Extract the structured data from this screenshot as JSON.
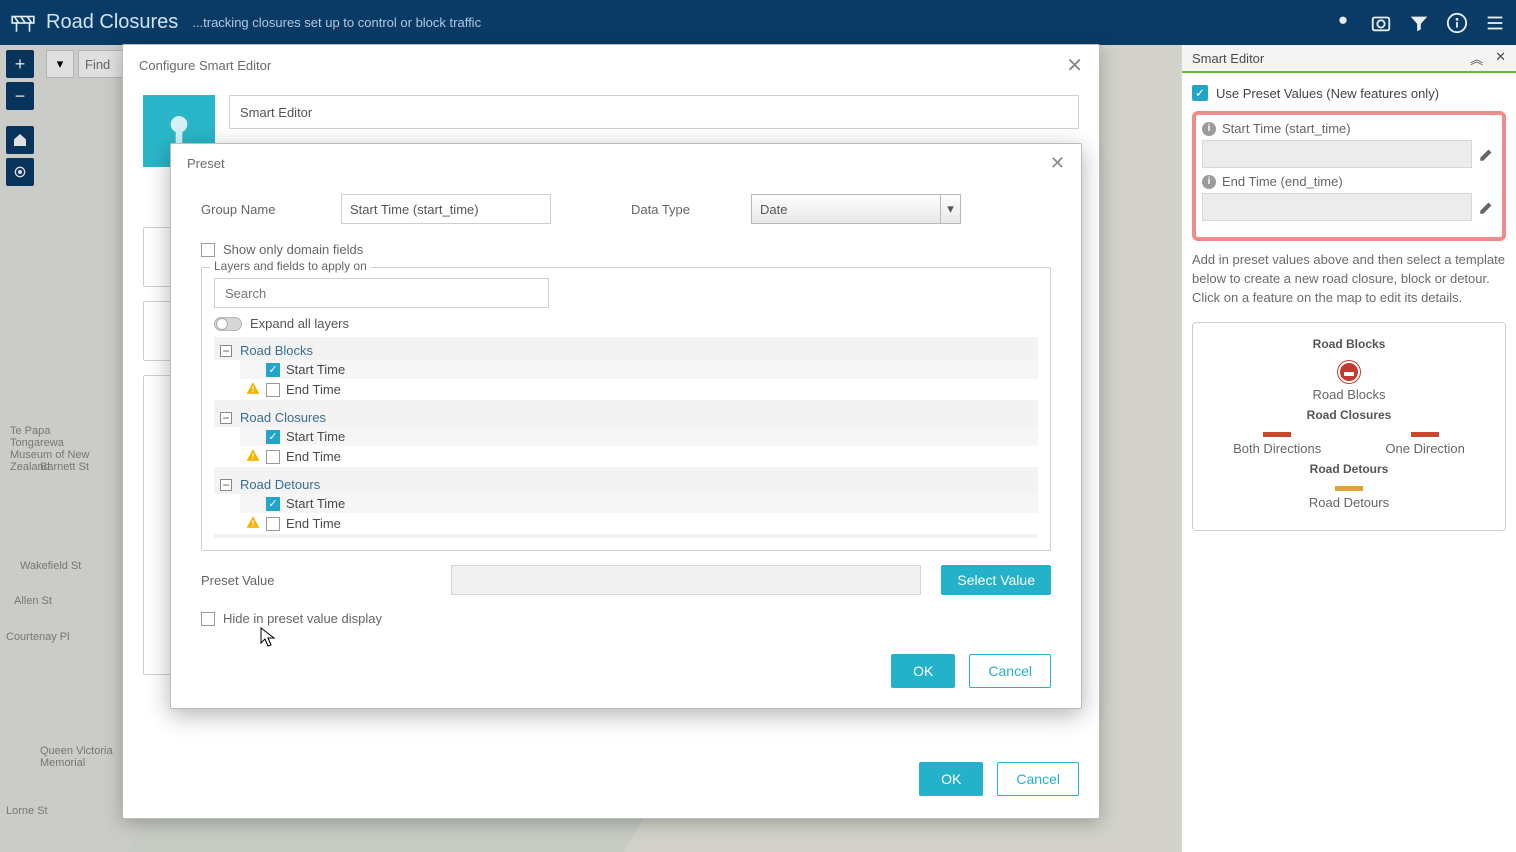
{
  "header": {
    "title": "Road Closures",
    "subtitle": "...tracking closures set up to control or block traffic"
  },
  "map_toolbar": {
    "find_placeholder": "Find"
  },
  "right_panel": {
    "title": "Smart Editor",
    "use_preset_label": "Use Preset Values (New features only)",
    "preset_fields": [
      {
        "label": "Start Time (start_time)"
      },
      {
        "label": "End Time (end_time)"
      }
    ],
    "instructions": "Add in preset values above and then select a template below to create a new road closure, block or detour. Click on a feature on the map to edit its details.",
    "templates": {
      "sec1_title": "Road Blocks",
      "sec1_item": "Road Blocks",
      "sec2_title": "Road Closures",
      "sec2_item1": "Both Directions",
      "sec2_item2": "One Direction",
      "sec3_title": "Road Detours",
      "sec3_item": "Road Detours"
    }
  },
  "outer_dialog": {
    "title": "Configure Smart Editor",
    "widget_name": "Smart Editor",
    "ok": "OK",
    "cancel": "Cancel"
  },
  "preset_dialog": {
    "title": "Preset",
    "group_name_label": "Group Name",
    "group_name_value": "Start Time (start_time)",
    "data_type_label": "Data Type",
    "data_type_value": "Date",
    "show_domain_label": "Show only domain fields",
    "layers_legend": "Layers and fields to apply on",
    "search_placeholder": "Search",
    "expand_label": "Expand all layers",
    "layers": [
      {
        "name": "Road Blocks",
        "fields": [
          {
            "label": "Start Time",
            "checked": true,
            "warn": false
          },
          {
            "label": "End Time",
            "checked": false,
            "warn": true
          }
        ]
      },
      {
        "name": "Road Closures",
        "fields": [
          {
            "label": "Start Time",
            "checked": true,
            "warn": false
          },
          {
            "label": "End Time",
            "checked": false,
            "warn": true
          }
        ]
      },
      {
        "name": "Road Detours",
        "fields": [
          {
            "label": "Start Time",
            "checked": true,
            "warn": false
          },
          {
            "label": "End Time",
            "checked": false,
            "warn": true
          }
        ]
      }
    ],
    "preset_value_label": "Preset Value",
    "select_value": "Select Value",
    "hide_label": "Hide in preset value display",
    "ok": "OK",
    "cancel": "Cancel"
  },
  "map_labels": {
    "l1": "Te Papa Tongarewa Museum of New Zealand",
    "l2": "Barnett St",
    "l3": "Wakefield St",
    "l4": "Allen St",
    "l5": "Courtenay Pl",
    "l6": "Queen Victoria Memorial",
    "l7": "Lorne St"
  }
}
